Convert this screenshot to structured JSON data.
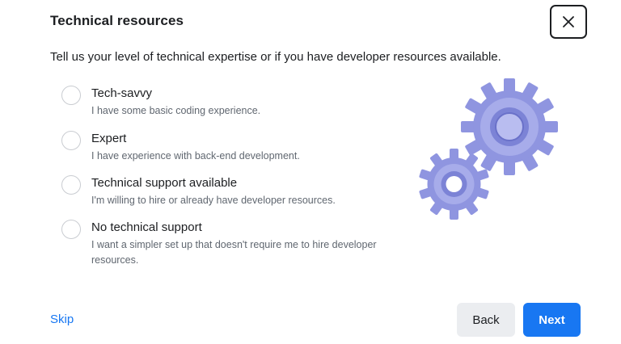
{
  "dialog": {
    "title": "Technical resources",
    "subtitle": "Tell us your level of technical expertise or if you have developer resources available.",
    "close_icon": "close-icon"
  },
  "options": [
    {
      "label": "Tech-savvy",
      "description": "I have some basic coding experience.",
      "selected": false
    },
    {
      "label": "Expert",
      "description": "I have experience with back-end development.",
      "selected": false
    },
    {
      "label": "Technical support available",
      "description": "I'm willing to hire or already have developer resources.",
      "selected": false
    },
    {
      "label": "No technical support",
      "description": "I want a simpler set up that doesn't require me to hire developer resources.",
      "selected": false
    }
  ],
  "illustration": {
    "icon": "gears-illustration",
    "color": "#8f95e0"
  },
  "footer": {
    "skip_label": "Skip",
    "back_label": "Back",
    "next_label": "Next"
  },
  "colors": {
    "accent": "#1877f2",
    "secondary_button": "#ebedf0",
    "text_primary": "#1c1e21",
    "text_secondary": "#606770"
  }
}
